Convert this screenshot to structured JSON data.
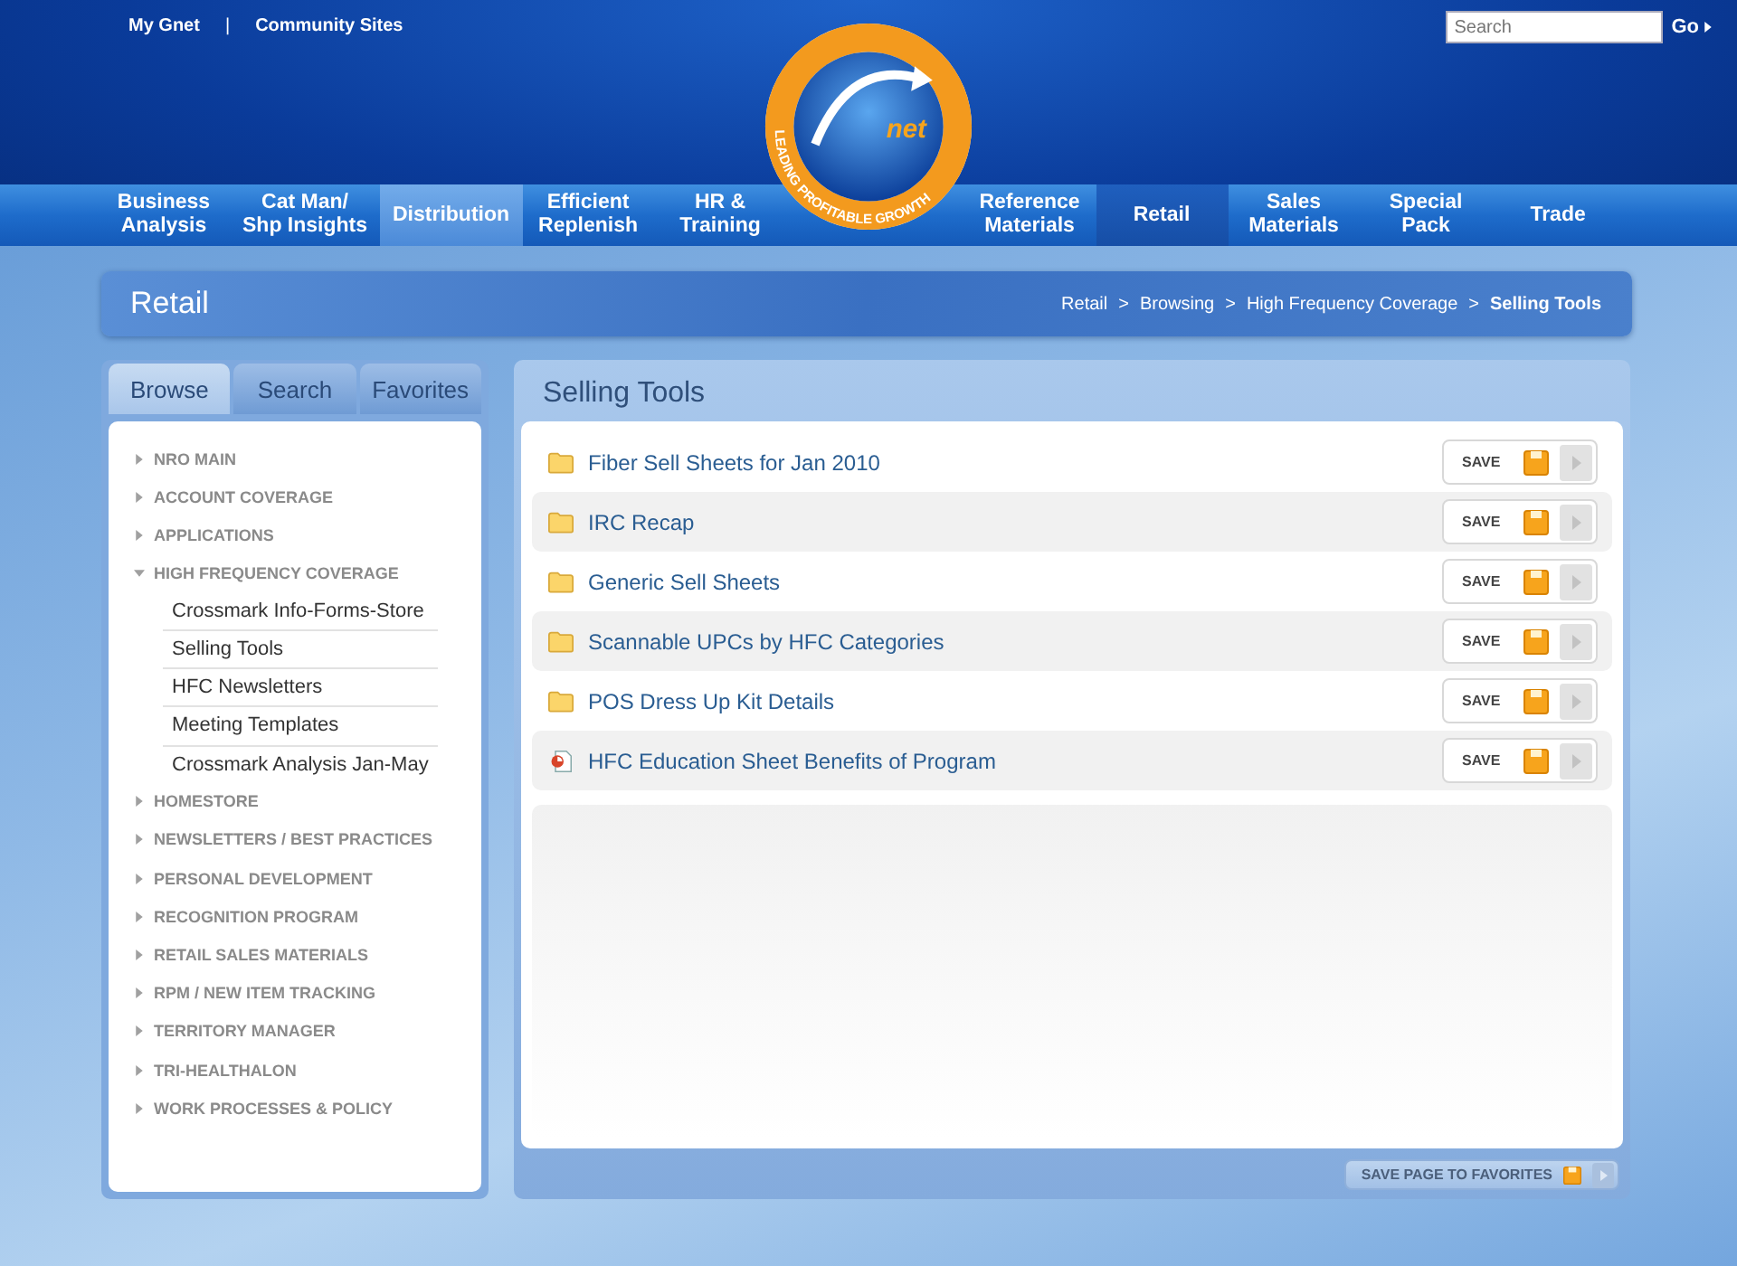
{
  "top_links": [
    "My Gnet",
    "Community Sites"
  ],
  "top_separator": "|",
  "search": {
    "placeholder": "Search",
    "button": "Go"
  },
  "logo": {
    "wordmark": "net",
    "tagline": "LEADING PROFITABLE GROWTH"
  },
  "nav_left": [
    {
      "label": "Business\nAnalysis",
      "selected": false,
      "hovered": false
    },
    {
      "label": "Cat Man/\nShp Insights",
      "selected": false,
      "hovered": false
    },
    {
      "label": "Distribution",
      "selected": false,
      "hovered": true
    },
    {
      "label": "Efficient\nReplenish",
      "selected": false,
      "hovered": false
    },
    {
      "label": "HR &\nTraining",
      "selected": false,
      "hovered": false
    }
  ],
  "nav_right": [
    {
      "label": "Reference\nMaterials",
      "selected": false,
      "hovered": false
    },
    {
      "label": "Retail",
      "selected": true,
      "hovered": false
    },
    {
      "label": "Sales\nMaterials",
      "selected": false,
      "hovered": false
    },
    {
      "label": "Special\nPack",
      "selected": false,
      "hovered": false
    },
    {
      "label": "Trade",
      "selected": false,
      "hovered": false
    }
  ],
  "page_title": "Retail",
  "breadcrumb": [
    {
      "label": "Retail",
      "current": false
    },
    {
      "label": "Browsing",
      "current": false
    },
    {
      "label": "High Frequency Coverage",
      "current": false
    },
    {
      "label": "Selling Tools",
      "current": true
    }
  ],
  "breadcrumb_separator": ">",
  "sidebar": {
    "tabs": [
      {
        "label": "Browse",
        "selected": true
      },
      {
        "label": "Search",
        "selected": false
      },
      {
        "label": "Favorites",
        "selected": false
      }
    ],
    "items": [
      {
        "label": "NRO MAIN",
        "expanded": false
      },
      {
        "label": "ACCOUNT COVERAGE",
        "expanded": false
      },
      {
        "label": "APPLICATIONS",
        "expanded": false
      },
      {
        "label": "HIGH FREQUENCY COVERAGE",
        "expanded": true,
        "children": [
          {
            "label": "Crossmark Info-Forms-Store"
          },
          {
            "label": "Selling Tools"
          },
          {
            "label": "HFC Newsletters"
          },
          {
            "label": "Meeting Templates"
          },
          {
            "label": "Crossmark Analysis Jan-May"
          }
        ]
      },
      {
        "label": "HOMESTORE",
        "expanded": false
      },
      {
        "label": "NEWSLETTERS / BEST PRACTICES",
        "expanded": false
      },
      {
        "label": "PERSONAL DEVELOPMENT",
        "expanded": false
      },
      {
        "label": "RECOGNITION PROGRAM",
        "expanded": false
      },
      {
        "label": "RETAIL SALES MATERIALS",
        "expanded": false
      },
      {
        "label": "RPM / NEW ITEM TRACKING",
        "expanded": false
      },
      {
        "label": "TERRITORY MANAGER",
        "expanded": false
      },
      {
        "label": "TRI-HEALTHALON",
        "expanded": false
      },
      {
        "label": "WORK PROCESSES & POLICY",
        "expanded": false
      }
    ]
  },
  "content": {
    "title": "Selling Tools",
    "items": [
      {
        "kind": "folder",
        "label": "Fiber Sell Sheets for Jan 2010",
        "action": "SAVE"
      },
      {
        "kind": "folder",
        "label": "IRC Recap",
        "action": "SAVE"
      },
      {
        "kind": "folder",
        "label": "Generic Sell Sheets",
        "action": "SAVE"
      },
      {
        "kind": "folder",
        "label": "Scannable UPCs by HFC Categories",
        "action": "SAVE"
      },
      {
        "kind": "folder",
        "label": "POS Dress Up Kit Details",
        "action": "SAVE"
      },
      {
        "kind": "presentation",
        "label": "HFC Education Sheet Benefits of Program",
        "action": "SAVE"
      }
    ]
  },
  "footer_button": "SAVE PAGE TO FAVORITES"
}
